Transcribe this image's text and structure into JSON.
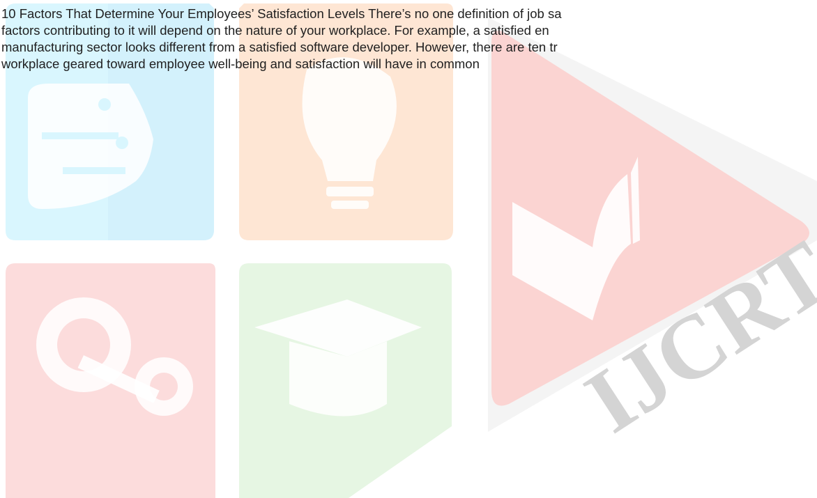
{
  "document": {
    "lines": [
      "10 Factors That Determine Your Employees’ Satisfaction Levels There’s no one definition of job sa",
      "factors contributing to it will depend on the nature of your workplace. For example, a satisfied en",
      "manufacturing sector looks different from a satisfied software developer. However, there are ten tr",
      "workplace geared toward employee well-being and satisfaction will have in common"
    ]
  },
  "watermark": {
    "logo_text": "IJCRT",
    "colors": {
      "cyan_tile": "#d6f5fd",
      "orange_tile": "#fde4d2",
      "red_tile": "#fbd9d9",
      "green_tile": "#e5f5e2",
      "play_triangle": "#fbd3d1",
      "triangle_outline": "#e6e6e6",
      "logo_letters": "#d2d2d2",
      "icon_white": "#ffffff"
    },
    "icons": [
      "circuit-icon",
      "light-bulb-icon",
      "gear-icon",
      "graduation-cap-icon",
      "book-icon"
    ]
  }
}
